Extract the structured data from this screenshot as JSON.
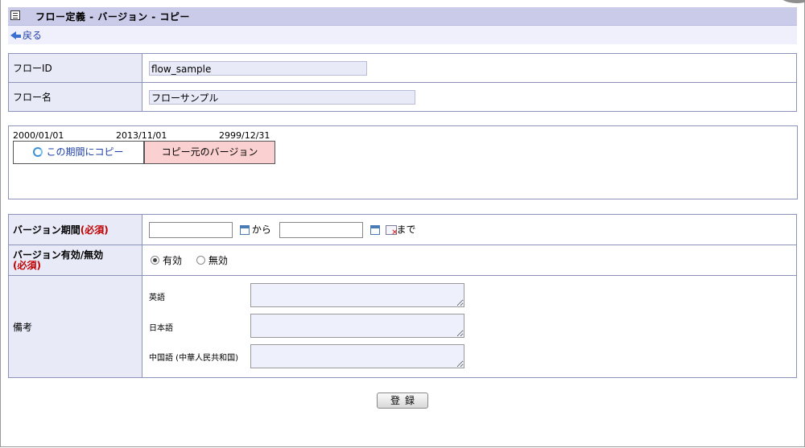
{
  "header": {
    "title": "フロー定義 - バージョン - コピー",
    "icon": "document-icon"
  },
  "nav": {
    "back_label": "戻る"
  },
  "flow": {
    "id_label": "フローID",
    "id_value": "flow_sample",
    "name_label": "フロー名",
    "name_value": "フローサンプル"
  },
  "timeline": {
    "dates": [
      "2000/01/01",
      "2013/11/01",
      "2999/12/31"
    ],
    "copy_label": "この期間にコピー",
    "source_label": "コピー元のバージョン",
    "source_color": "#fbd0d0"
  },
  "version": {
    "period_label": "バージョン期間",
    "required": "(必須)",
    "from_text": "から",
    "to_text": "まで",
    "start_value": "",
    "end_value": "",
    "valid_label": "バージョン有効/無効",
    "valid_required": "(必須)",
    "options": [
      "有効",
      "無効"
    ],
    "selected": "有効"
  },
  "notes": {
    "label": "備考",
    "langs": [
      "英語",
      "日本語",
      "中国語 (中華人民共和国)"
    ]
  },
  "submit_label": "登録"
}
